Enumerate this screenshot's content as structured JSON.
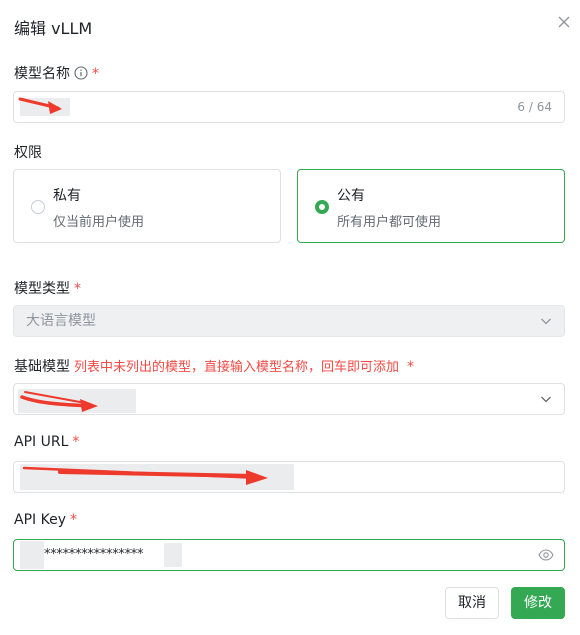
{
  "dialog": {
    "title": "编辑 vLLM",
    "close_icon": "close-icon"
  },
  "model_name": {
    "label": "模型名称",
    "counter": "6 / 64",
    "info_icon": "info-circle-icon"
  },
  "permission": {
    "label": "权限",
    "options": [
      {
        "title": "私有",
        "desc": "仅当前用户使用",
        "selected": false
      },
      {
        "title": "公有",
        "desc": "所有用户都可使用",
        "selected": true
      }
    ]
  },
  "model_type": {
    "label": "模型类型",
    "value": "大语言模型"
  },
  "base_model": {
    "label": "基础模型",
    "hint": "列表中未列出的模型，直接输入模型名称，回车即可添加"
  },
  "api_url": {
    "label": "API URL"
  },
  "api_key": {
    "label": "API Key",
    "value": "****************"
  },
  "buttons": {
    "cancel": "取消",
    "submit": "修改"
  },
  "required_mark": "*",
  "colors": {
    "accent": "#34a853",
    "required": "#f54a45",
    "redaction": "#ee3a2c"
  }
}
